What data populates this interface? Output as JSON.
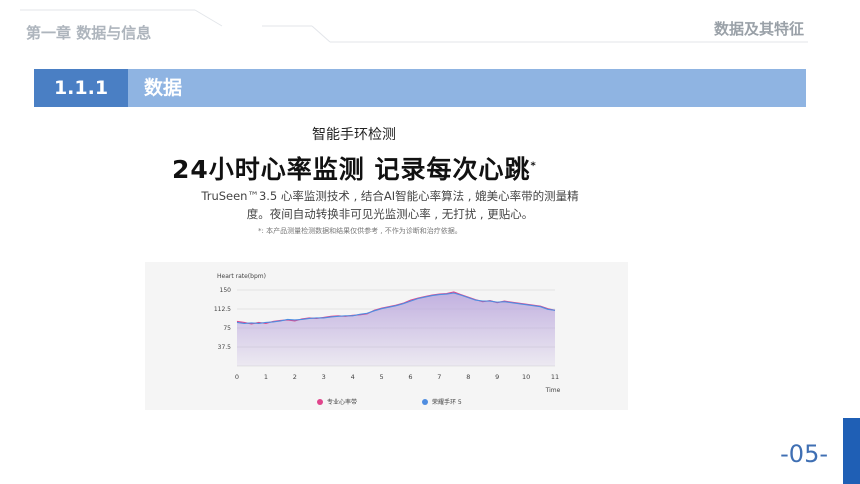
{
  "header": {
    "chapter": "第一章 数据与信息",
    "topic": "数据及其特征"
  },
  "section": {
    "number": "1.1.1",
    "title": "数据"
  },
  "caption": "智能手环检测",
  "ad": {
    "headline": "24小时心率监测 记录每次心跳",
    "headline_mark": "*",
    "description_line1": "TruSeen™3.5 心率监测技术 , 结合AI智能心率算法 , 媲美心率带的测量精",
    "description_line2": "度。夜间自动转换非可见光监测心率 , 无打扰 , 更贴心。",
    "note": "*: 本产品测量检测数据和结果仅供参考 , 不作为诊断和治疗依据。"
  },
  "page_number": "-05-",
  "colors": {
    "accent": "#4a7fc4",
    "bar": "#8fb4e2",
    "series_pink": "#e0458c",
    "series_blue": "#4f8de0",
    "fill": "#b9a5dc"
  },
  "chart_data": {
    "type": "line",
    "ylabel": "Heart rate(bpm)",
    "xlabel": "Time",
    "xlim": [
      0,
      11
    ],
    "ylim": [
      0,
      150
    ],
    "xticks": [
      "0",
      "1",
      "2",
      "3",
      "4",
      "5",
      "6",
      "7",
      "8",
      "9",
      "10",
      "11"
    ],
    "yticks": [
      "150",
      "112.5",
      "75",
      "37.5"
    ],
    "legend_position": "bottom",
    "series": [
      {
        "name": "专业心率带",
        "color": "#e0458c",
        "x": [
          0,
          0.25,
          0.5,
          0.75,
          1,
          1.25,
          1.5,
          1.75,
          2,
          2.25,
          2.5,
          2.75,
          3,
          3.25,
          3.5,
          3.75,
          4,
          4.25,
          4.5,
          4.75,
          5,
          5.25,
          5.5,
          5.75,
          6,
          6.25,
          6.5,
          6.75,
          7,
          7.25,
          7.5,
          7.75,
          8,
          8.25,
          8.5,
          8.75,
          9,
          9.25,
          9.5,
          9.75,
          10,
          10.25,
          10.5,
          10.75,
          11
        ],
        "y": [
          88,
          86,
          83,
          86,
          84,
          88,
          90,
          91,
          89,
          93,
          95,
          94,
          96,
          98,
          99,
          98,
          100,
          101,
          103,
          110,
          114,
          117,
          120,
          124,
          130,
          134,
          137,
          140,
          142,
          143,
          146,
          141,
          136,
          131,
          127,
          129,
          125,
          128,
          126,
          124,
          122,
          120,
          118,
          113,
          110
        ]
      },
      {
        "name": "荣耀手环 5",
        "color": "#4f8de0",
        "x": [
          0,
          0.25,
          0.5,
          0.75,
          1,
          1.25,
          1.5,
          1.75,
          2,
          2.25,
          2.5,
          2.75,
          3,
          3.25,
          3.5,
          3.75,
          4,
          4.25,
          4.5,
          4.75,
          5,
          5.25,
          5.5,
          5.75,
          6,
          6.25,
          6.5,
          6.75,
          7,
          7.25,
          7.5,
          7.75,
          8,
          8.25,
          8.5,
          8.75,
          9,
          9.25,
          9.5,
          9.75,
          10,
          10.25,
          10.5,
          10.75,
          11
        ],
        "y": [
          86,
          84,
          85,
          84,
          86,
          87,
          89,
          92,
          91,
          92,
          94,
          95,
          95,
          97,
          98,
          99,
          99,
          102,
          104,
          109,
          113,
          116,
          119,
          123,
          128,
          133,
          136,
          139,
          141,
          142,
          144,
          140,
          135,
          130,
          128,
          128,
          126,
          127,
          125,
          123,
          121,
          119,
          117,
          112,
          110
        ]
      }
    ]
  }
}
